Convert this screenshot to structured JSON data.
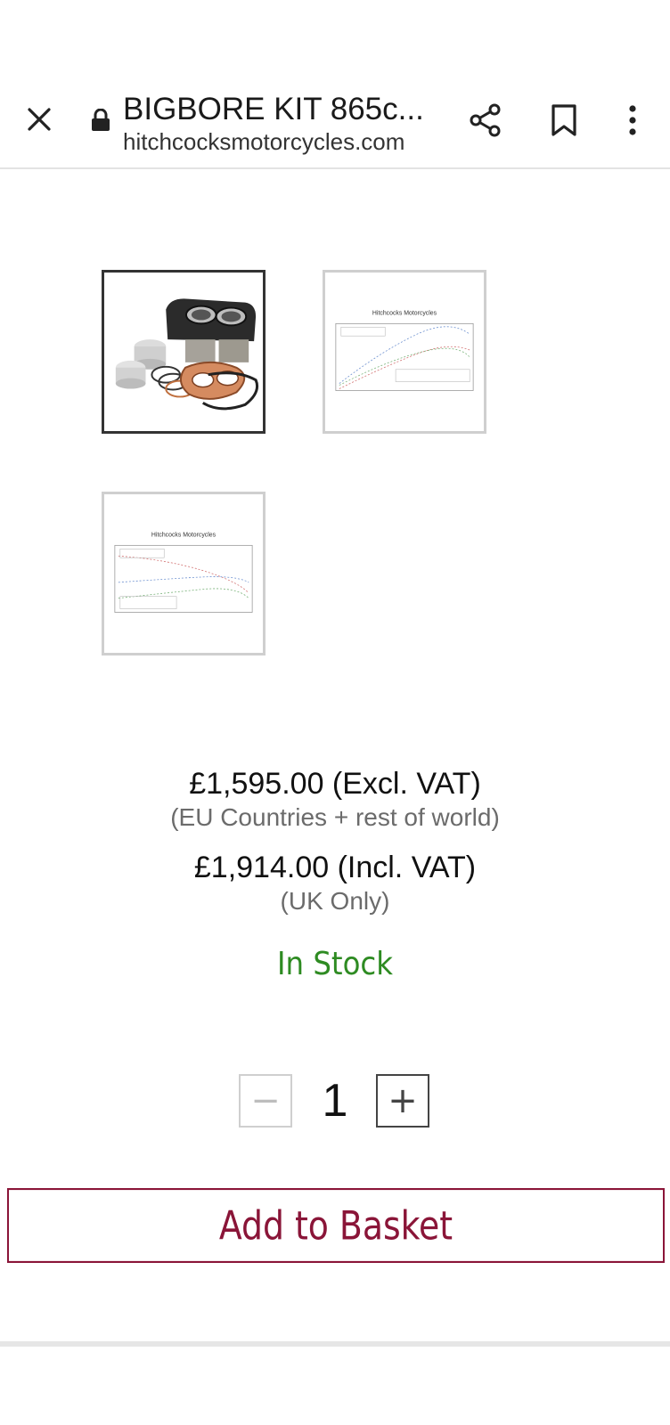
{
  "browser": {
    "title": "BIGBORE KIT 865c...",
    "url": "hitchcocksmotorcycles.com",
    "icons": {
      "close": "close-icon",
      "lock": "lock-icon",
      "share": "share-icon",
      "bookmark": "bookmark-icon",
      "more": "more-vert-icon"
    }
  },
  "gallery": {
    "images": [
      {
        "name": "product-photo-thumb",
        "kind": "photo",
        "selected": true
      },
      {
        "name": "dyno-chart-thumb-1",
        "kind": "chart",
        "selected": false,
        "chart_title": "Hitchcocks Motorcycles"
      },
      {
        "name": "dyno-chart-thumb-2",
        "kind": "chart",
        "selected": false,
        "chart_title": "Hitchcocks Motorcycles"
      }
    ]
  },
  "pricing": {
    "excl_vat": "£1,595.00 (Excl. VAT)",
    "excl_note": "(EU Countries + rest of world)",
    "incl_vat": "£1,914.00 (Incl. VAT)",
    "incl_note": "(UK Only)",
    "stock": "In Stock"
  },
  "quantity": {
    "value": "1",
    "minus": "−",
    "plus": "+"
  },
  "actions": {
    "add_to_basket": "Add to Basket"
  },
  "colors": {
    "accent": "#8a1538",
    "stock": "#2e8b22"
  }
}
